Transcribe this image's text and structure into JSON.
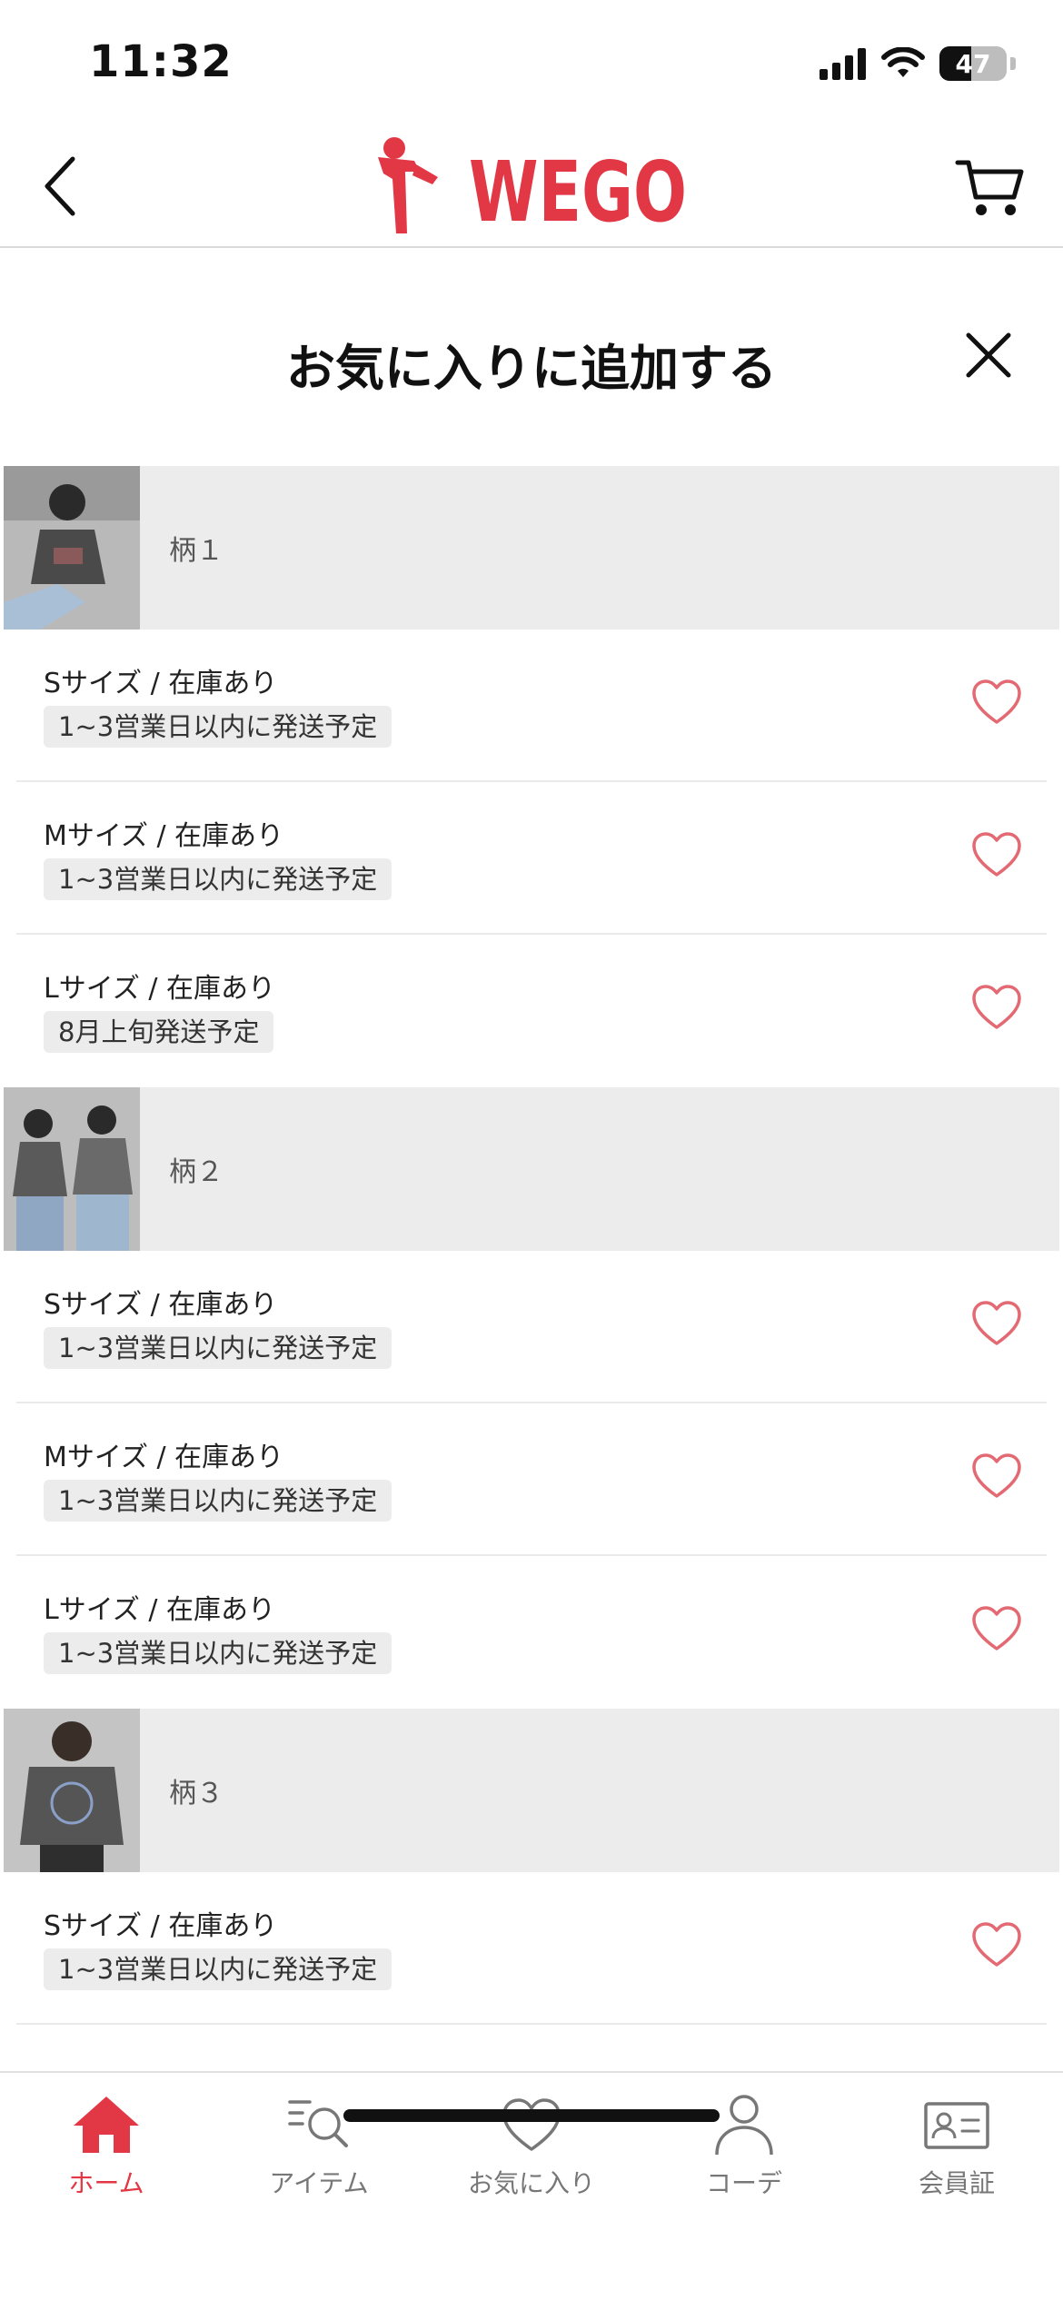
{
  "status_bar": {
    "time": "11:32",
    "battery": "47",
    "icons": [
      "signal-icon",
      "wifi-icon",
      "battery-icon"
    ]
  },
  "header": {
    "logo_text": "WEGO",
    "brand_color": "#e23744",
    "back_icon": "chevron-left-icon",
    "cart_icon": "cart-icon"
  },
  "modal": {
    "title": "お気に入りに追加する",
    "close_icon": "close-icon"
  },
  "groups": [
    {
      "label": "柄１",
      "sizes": [
        {
          "size": "Sサイズ / 在庫あり",
          "shipping": "1~3営業日以内に発送予定"
        },
        {
          "size": "Mサイズ / 在庫あり",
          "shipping": "1~3営業日以内に発送予定"
        },
        {
          "size": "Lサイズ / 在庫あり",
          "shipping": "8月上旬発送予定"
        }
      ]
    },
    {
      "label": "柄２",
      "sizes": [
        {
          "size": "Sサイズ / 在庫あり",
          "shipping": "1~3営業日以内に発送予定"
        },
        {
          "size": "Mサイズ / 在庫あり",
          "shipping": "1~3営業日以内に発送予定"
        },
        {
          "size": "Lサイズ / 在庫あり",
          "shipping": "1~3営業日以内に発送予定"
        }
      ]
    },
    {
      "label": "柄３",
      "sizes": [
        {
          "size": "Sサイズ / 在庫あり",
          "shipping": "1~3営業日以内に発送予定"
        }
      ]
    }
  ],
  "tab_bar": {
    "tabs": [
      {
        "label": "ホーム",
        "icon": "home-icon",
        "active": true
      },
      {
        "label": "アイテム",
        "icon": "search-list-icon",
        "active": false
      },
      {
        "label": "お気に入り",
        "icon": "heart-icon",
        "active": false
      },
      {
        "label": "コーデ",
        "icon": "person-icon",
        "active": false
      },
      {
        "label": "会員証",
        "icon": "member-card-icon",
        "active": false
      }
    ],
    "active_color": "#e23744"
  }
}
